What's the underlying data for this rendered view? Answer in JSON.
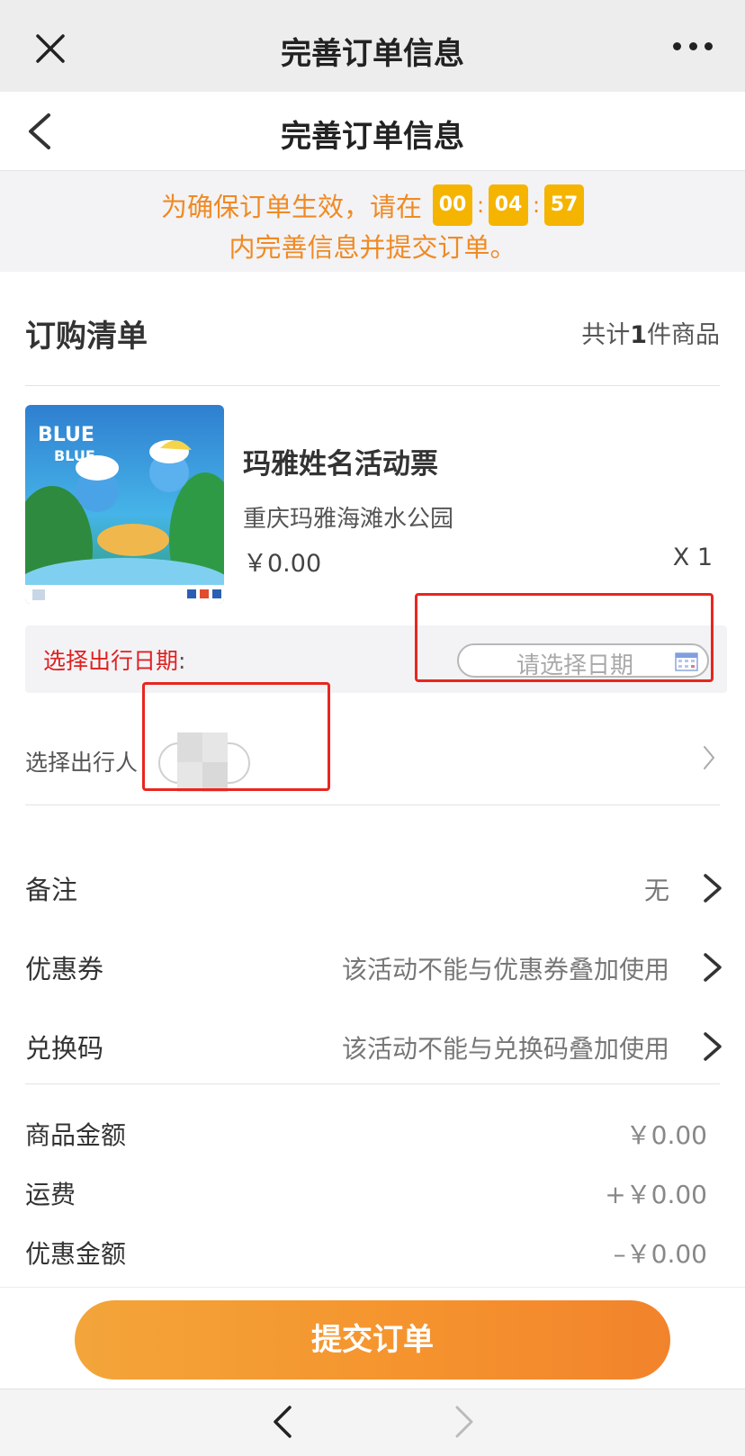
{
  "wechat_bar": {
    "title": "完善订单信息"
  },
  "header": {
    "title": "完善订单信息"
  },
  "countdown": {
    "prefix": "为确保订单生效，请在",
    "hours": "00",
    "minutes": "04",
    "seconds": "57",
    "sep": ":",
    "suffix": "内完善信息并提交订单。"
  },
  "order": {
    "section_title": "订购清单",
    "count_prefix": "共计",
    "count": "1",
    "count_suffix": "件商品"
  },
  "product": {
    "name": "玛雅姓名活动票",
    "venue": "重庆玛雅海滩水公园",
    "price": "￥0.00",
    "qty": "X 1",
    "image_text_1": "BLUE",
    "image_text_2": "BLUE"
  },
  "travel_date": {
    "label": "选择出行日期",
    "colon": ":",
    "placeholder": "请选择日期"
  },
  "traveler": {
    "label": "选择出行人"
  },
  "options": [
    {
      "label": "备注",
      "value": "无"
    },
    {
      "label": "优惠券",
      "value": "该活动不能与优惠券叠加使用"
    },
    {
      "label": "兑换码",
      "value": "该活动不能与兑换码叠加使用"
    }
  ],
  "amounts": [
    {
      "label": "商品金额",
      "value": "￥0.00"
    },
    {
      "label": "运费",
      "value": "+￥0.00"
    },
    {
      "label": "优惠金额",
      "value": "–￥0.00"
    }
  ],
  "submit": {
    "label": "提交订单"
  },
  "colors": {
    "accent_orange": "#f08a24",
    "countdown_box": "#f5b400",
    "required_red": "#e02020",
    "annotation_red": "#e8261e"
  },
  "icons": [
    "close-icon",
    "more-icon",
    "back-arrow-icon",
    "calendar-icon",
    "chevron-right-icon",
    "browser-back-icon",
    "browser-forward-icon"
  ]
}
